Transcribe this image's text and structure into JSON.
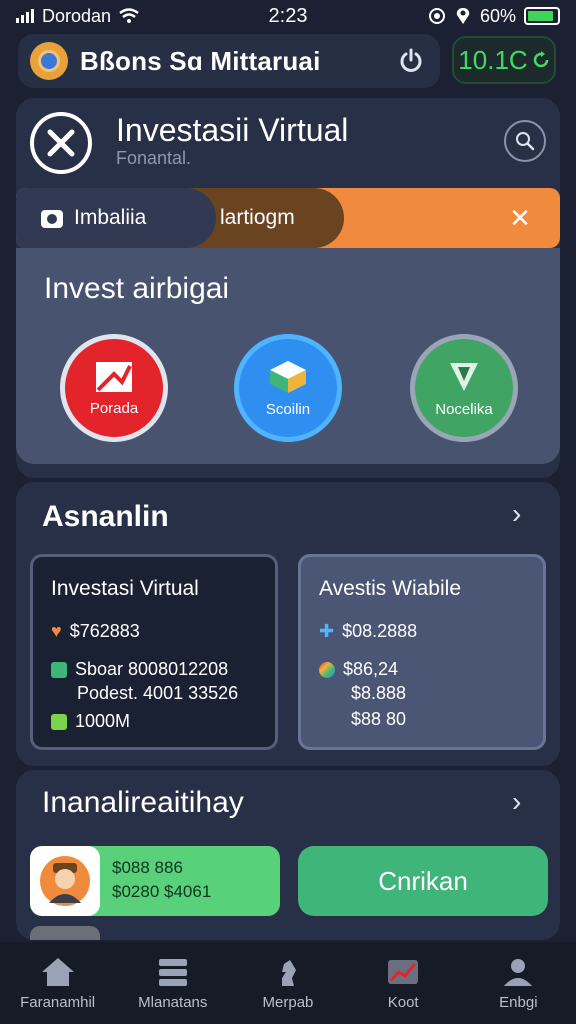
{
  "status": {
    "carrier": "Dorodan",
    "time": "2:23",
    "battery": "60%",
    "battery_level": 0.9
  },
  "header": {
    "app_title": "Bßons Sɑ Mittaruai",
    "balance": "10.1C"
  },
  "page": {
    "title": "Investasii Virtual",
    "subtitle": "Fonantal."
  },
  "banner": {
    "left_label": "Imbaliia",
    "mid_label": "lartiogm"
  },
  "invest": {
    "title": "Invest airbigai",
    "options": [
      {
        "label": "Porada",
        "color": "#e3242b"
      },
      {
        "label": "Scoilin",
        "color": "#2f8ff0"
      },
      {
        "label": "Nocelika",
        "color": "#3fa464"
      }
    ]
  },
  "assets": {
    "title": "Asnanlin",
    "box1": {
      "title": "Investasi Virtual",
      "amount": "$762883",
      "line1": "Sboar 8008012208",
      "line2": "Podest. 4001 33526",
      "line3": "1000M"
    },
    "box2": {
      "title": "Avestis Wiabile",
      "amount": "$08.2888",
      "line1": "$86,24",
      "line2": "$8.888",
      "line3": "$88 80"
    }
  },
  "history": {
    "title": "Inanalireaitihay",
    "item": {
      "line1": "$088 886",
      "line2": "$0280 $4061"
    },
    "confirm_label": "Cnrikan"
  },
  "nav": [
    {
      "label": "Faranamhil",
      "icon": "home-icon"
    },
    {
      "label": "Mlanatans",
      "icon": "layers-icon"
    },
    {
      "label": "Merpab",
      "icon": "chess-icon"
    },
    {
      "label": "Koot",
      "icon": "chart-icon"
    },
    {
      "label": "Enbgi",
      "icon": "profile-icon"
    }
  ],
  "colors": {
    "accent_orange": "#f08a3c",
    "positive_green": "#3fdc63",
    "panel": "#273047"
  }
}
